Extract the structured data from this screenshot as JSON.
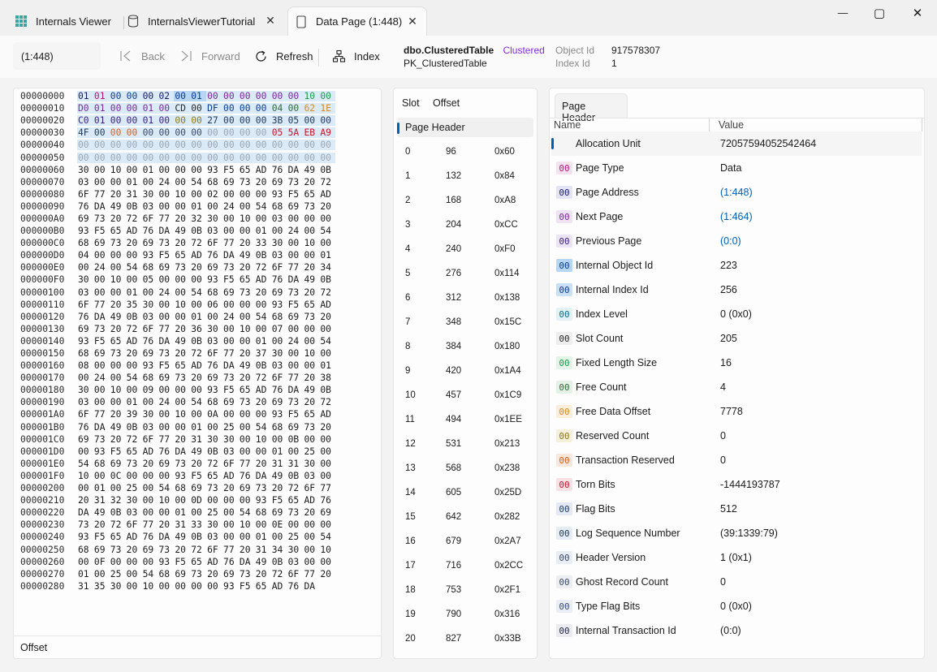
{
  "tabs": [
    {
      "label": "Internals Viewer"
    },
    {
      "label": "InternalsViewerTutorial"
    },
    {
      "label": "Data Page (1:448)"
    }
  ],
  "window": {
    "minimize": "—",
    "maximize": "▢",
    "close": "✕"
  },
  "toolbar": {
    "address": "(1:448)",
    "back": "Back",
    "forward": "Forward",
    "refresh": "Refresh",
    "index": "Index"
  },
  "object_info": {
    "table_name": "dbo.ClusteredTable",
    "index_type": "Clustered",
    "index_name": "PK_ClusteredTable",
    "object_id_label": "Object Id",
    "object_id_value": "917578307",
    "index_id_label": "Index Id",
    "index_id_value": "1"
  },
  "colors": {
    "accent": "#005fb8",
    "header_bytes_bg": "#dbeaf7",
    "selected_bytes_bg": "#b7d6f4"
  },
  "hex": {
    "footer": "Offset",
    "rows": [
      {
        "offset": "00000000",
        "bytes": [
          "01",
          "01",
          "00",
          "00",
          "00",
          "02",
          "00",
          "01",
          "00",
          "00",
          "00",
          "00",
          "00",
          "00",
          "10",
          "00"
        ]
      },
      {
        "offset": "00000010",
        "bytes": [
          "D0",
          "01",
          "00",
          "00",
          "01",
          "00",
          "CD",
          "00",
          "DF",
          "00",
          "00",
          "00",
          "04",
          "00",
          "62",
          "1E"
        ]
      },
      {
        "offset": "00000020",
        "bytes": [
          "C0",
          "01",
          "00",
          "00",
          "01",
          "00",
          "00",
          "00",
          "27",
          "00",
          "00",
          "00",
          "3B",
          "05",
          "00",
          "00"
        ]
      },
      {
        "offset": "00000030",
        "bytes": [
          "4F",
          "00",
          "00",
          "00",
          "00",
          "00",
          "00",
          "00",
          "00",
          "00",
          "00",
          "00",
          "05",
          "5A",
          "EB",
          "A9"
        ]
      },
      {
        "offset": "00000040",
        "bytes": [
          "00",
          "00",
          "00",
          "00",
          "00",
          "00",
          "00",
          "00",
          "00",
          "00",
          "00",
          "00",
          "00",
          "00",
          "00",
          "00"
        ]
      },
      {
        "offset": "00000050",
        "bytes": [
          "00",
          "00",
          "00",
          "00",
          "00",
          "00",
          "00",
          "00",
          "00",
          "00",
          "00",
          "00",
          "00",
          "00",
          "00",
          "00"
        ]
      },
      {
        "offset": "00000060",
        "bytes": [
          "30",
          "00",
          "10",
          "00",
          "01",
          "00",
          "00",
          "00",
          "93",
          "F5",
          "65",
          "AD",
          "76",
          "DA",
          "49",
          "0B"
        ]
      },
      {
        "offset": "00000070",
        "bytes": [
          "03",
          "00",
          "00",
          "01",
          "00",
          "24",
          "00",
          "54",
          "68",
          "69",
          "73",
          "20",
          "69",
          "73",
          "20",
          "72"
        ]
      },
      {
        "offset": "00000080",
        "bytes": [
          "6F",
          "77",
          "20",
          "31",
          "30",
          "00",
          "10",
          "00",
          "02",
          "00",
          "00",
          "00",
          "93",
          "F5",
          "65",
          "AD"
        ]
      },
      {
        "offset": "00000090",
        "bytes": [
          "76",
          "DA",
          "49",
          "0B",
          "03",
          "00",
          "00",
          "01",
          "00",
          "24",
          "00",
          "54",
          "68",
          "69",
          "73",
          "20"
        ]
      },
      {
        "offset": "000000A0",
        "bytes": [
          "69",
          "73",
          "20",
          "72",
          "6F",
          "77",
          "20",
          "32",
          "30",
          "00",
          "10",
          "00",
          "03",
          "00",
          "00",
          "00"
        ]
      },
      {
        "offset": "000000B0",
        "bytes": [
          "93",
          "F5",
          "65",
          "AD",
          "76",
          "DA",
          "49",
          "0B",
          "03",
          "00",
          "00",
          "01",
          "00",
          "24",
          "00",
          "54"
        ]
      },
      {
        "offset": "000000C0",
        "bytes": [
          "68",
          "69",
          "73",
          "20",
          "69",
          "73",
          "20",
          "72",
          "6F",
          "77",
          "20",
          "33",
          "30",
          "00",
          "10",
          "00"
        ]
      },
      {
        "offset": "000000D0",
        "bytes": [
          "04",
          "00",
          "00",
          "00",
          "93",
          "F5",
          "65",
          "AD",
          "76",
          "DA",
          "49",
          "0B",
          "03",
          "00",
          "00",
          "01"
        ]
      },
      {
        "offset": "000000E0",
        "bytes": [
          "00",
          "24",
          "00",
          "54",
          "68",
          "69",
          "73",
          "20",
          "69",
          "73",
          "20",
          "72",
          "6F",
          "77",
          "20",
          "34"
        ]
      },
      {
        "offset": "000000F0",
        "bytes": [
          "30",
          "00",
          "10",
          "00",
          "05",
          "00",
          "00",
          "00",
          "93",
          "F5",
          "65",
          "AD",
          "76",
          "DA",
          "49",
          "0B"
        ]
      },
      {
        "offset": "00000100",
        "bytes": [
          "03",
          "00",
          "00",
          "01",
          "00",
          "24",
          "00",
          "54",
          "68",
          "69",
          "73",
          "20",
          "69",
          "73",
          "20",
          "72"
        ]
      },
      {
        "offset": "00000110",
        "bytes": [
          "6F",
          "77",
          "20",
          "35",
          "30",
          "00",
          "10",
          "00",
          "06",
          "00",
          "00",
          "00",
          "93",
          "F5",
          "65",
          "AD"
        ]
      },
      {
        "offset": "00000120",
        "bytes": [
          "76",
          "DA",
          "49",
          "0B",
          "03",
          "00",
          "00",
          "01",
          "00",
          "24",
          "00",
          "54",
          "68",
          "69",
          "73",
          "20"
        ]
      },
      {
        "offset": "00000130",
        "bytes": [
          "69",
          "73",
          "20",
          "72",
          "6F",
          "77",
          "20",
          "36",
          "30",
          "00",
          "10",
          "00",
          "07",
          "00",
          "00",
          "00"
        ]
      },
      {
        "offset": "00000140",
        "bytes": [
          "93",
          "F5",
          "65",
          "AD",
          "76",
          "DA",
          "49",
          "0B",
          "03",
          "00",
          "00",
          "01",
          "00",
          "24",
          "00",
          "54"
        ]
      },
      {
        "offset": "00000150",
        "bytes": [
          "68",
          "69",
          "73",
          "20",
          "69",
          "73",
          "20",
          "72",
          "6F",
          "77",
          "20",
          "37",
          "30",
          "00",
          "10",
          "00"
        ]
      },
      {
        "offset": "00000160",
        "bytes": [
          "08",
          "00",
          "00",
          "00",
          "93",
          "F5",
          "65",
          "AD",
          "76",
          "DA",
          "49",
          "0B",
          "03",
          "00",
          "00",
          "01"
        ]
      },
      {
        "offset": "00000170",
        "bytes": [
          "00",
          "24",
          "00",
          "54",
          "68",
          "69",
          "73",
          "20",
          "69",
          "73",
          "20",
          "72",
          "6F",
          "77",
          "20",
          "38"
        ]
      },
      {
        "offset": "00000180",
        "bytes": [
          "30",
          "00",
          "10",
          "00",
          "09",
          "00",
          "00",
          "00",
          "93",
          "F5",
          "65",
          "AD",
          "76",
          "DA",
          "49",
          "0B"
        ]
      },
      {
        "offset": "00000190",
        "bytes": [
          "03",
          "00",
          "00",
          "01",
          "00",
          "24",
          "00",
          "54",
          "68",
          "69",
          "73",
          "20",
          "69",
          "73",
          "20",
          "72"
        ]
      },
      {
        "offset": "000001A0",
        "bytes": [
          "6F",
          "77",
          "20",
          "39",
          "30",
          "00",
          "10",
          "00",
          "0A",
          "00",
          "00",
          "00",
          "93",
          "F5",
          "65",
          "AD"
        ]
      },
      {
        "offset": "000001B0",
        "bytes": [
          "76",
          "DA",
          "49",
          "0B",
          "03",
          "00",
          "00",
          "01",
          "00",
          "25",
          "00",
          "54",
          "68",
          "69",
          "73",
          "20"
        ]
      },
      {
        "offset": "000001C0",
        "bytes": [
          "69",
          "73",
          "20",
          "72",
          "6F",
          "77",
          "20",
          "31",
          "30",
          "30",
          "00",
          "10",
          "00",
          "0B",
          "00",
          "00"
        ]
      },
      {
        "offset": "000001D0",
        "bytes": [
          "00",
          "93",
          "F5",
          "65",
          "AD",
          "76",
          "DA",
          "49",
          "0B",
          "03",
          "00",
          "00",
          "01",
          "00",
          "25",
          "00"
        ]
      },
      {
        "offset": "000001E0",
        "bytes": [
          "54",
          "68",
          "69",
          "73",
          "20",
          "69",
          "73",
          "20",
          "72",
          "6F",
          "77",
          "20",
          "31",
          "31",
          "30",
          "00"
        ]
      },
      {
        "offset": "000001F0",
        "bytes": [
          "10",
          "00",
          "0C",
          "00",
          "00",
          "00",
          "93",
          "F5",
          "65",
          "AD",
          "76",
          "DA",
          "49",
          "0B",
          "03",
          "00"
        ]
      },
      {
        "offset": "00000200",
        "bytes": [
          "00",
          "01",
          "00",
          "25",
          "00",
          "54",
          "68",
          "69",
          "73",
          "20",
          "69",
          "73",
          "20",
          "72",
          "6F",
          "77"
        ]
      },
      {
        "offset": "00000210",
        "bytes": [
          "20",
          "31",
          "32",
          "30",
          "00",
          "10",
          "00",
          "0D",
          "00",
          "00",
          "00",
          "93",
          "F5",
          "65",
          "AD",
          "76"
        ]
      },
      {
        "offset": "00000220",
        "bytes": [
          "DA",
          "49",
          "0B",
          "03",
          "00",
          "00",
          "01",
          "00",
          "25",
          "00",
          "54",
          "68",
          "69",
          "73",
          "20",
          "69"
        ]
      },
      {
        "offset": "00000230",
        "bytes": [
          "73",
          "20",
          "72",
          "6F",
          "77",
          "20",
          "31",
          "33",
          "30",
          "00",
          "10",
          "00",
          "0E",
          "00",
          "00",
          "00"
        ]
      },
      {
        "offset": "00000240",
        "bytes": [
          "93",
          "F5",
          "65",
          "AD",
          "76",
          "DA",
          "49",
          "0B",
          "03",
          "00",
          "00",
          "01",
          "00",
          "25",
          "00",
          "54"
        ]
      },
      {
        "offset": "00000250",
        "bytes": [
          "68",
          "69",
          "73",
          "20",
          "69",
          "73",
          "20",
          "72",
          "6F",
          "77",
          "20",
          "31",
          "34",
          "30",
          "00",
          "10"
        ]
      },
      {
        "offset": "00000260",
        "bytes": [
          "00",
          "0F",
          "00",
          "00",
          "00",
          "93",
          "F5",
          "65",
          "AD",
          "76",
          "DA",
          "49",
          "0B",
          "03",
          "00",
          "00"
        ]
      },
      {
        "offset": "00000270",
        "bytes": [
          "01",
          "00",
          "25",
          "00",
          "54",
          "68",
          "69",
          "73",
          "20",
          "69",
          "73",
          "20",
          "72",
          "6F",
          "77",
          "20"
        ]
      },
      {
        "offset": "00000280",
        "bytes": [
          "31",
          "35",
          "30",
          "00",
          "10",
          "00",
          "00",
          "00",
          "00",
          "93",
          "F5",
          "65",
          "AD",
          "76",
          "DA"
        ]
      }
    ]
  },
  "slots": {
    "columns": [
      "Slot",
      "Offset"
    ],
    "selected_label": "Page Header",
    "rows": [
      {
        "slot": "0",
        "offset": "96",
        "hex": "0x60"
      },
      {
        "slot": "1",
        "offset": "132",
        "hex": "0x84"
      },
      {
        "slot": "2",
        "offset": "168",
        "hex": "0xA8"
      },
      {
        "slot": "3",
        "offset": "204",
        "hex": "0xCC"
      },
      {
        "slot": "4",
        "offset": "240",
        "hex": "0xF0"
      },
      {
        "slot": "5",
        "offset": "276",
        "hex": "0x114"
      },
      {
        "slot": "6",
        "offset": "312",
        "hex": "0x138"
      },
      {
        "slot": "7",
        "offset": "348",
        "hex": "0x15C"
      },
      {
        "slot": "8",
        "offset": "384",
        "hex": "0x180"
      },
      {
        "slot": "9",
        "offset": "420",
        "hex": "0x1A4"
      },
      {
        "slot": "10",
        "offset": "457",
        "hex": "0x1C9"
      },
      {
        "slot": "11",
        "offset": "494",
        "hex": "0x1EE"
      },
      {
        "slot": "12",
        "offset": "531",
        "hex": "0x213"
      },
      {
        "slot": "13",
        "offset": "568",
        "hex": "0x238"
      },
      {
        "slot": "14",
        "offset": "605",
        "hex": "0x25D"
      },
      {
        "slot": "15",
        "offset": "642",
        "hex": "0x282"
      },
      {
        "slot": "16",
        "offset": "679",
        "hex": "0x2A7"
      },
      {
        "slot": "17",
        "offset": "716",
        "hex": "0x2CC"
      },
      {
        "slot": "18",
        "offset": "753",
        "hex": "0x2F1"
      },
      {
        "slot": "19",
        "offset": "790",
        "hex": "0x316"
      },
      {
        "slot": "20",
        "offset": "827",
        "hex": "0x33B"
      }
    ]
  },
  "page_header": {
    "tab": "Page Header",
    "columns": [
      "Name",
      "Value"
    ],
    "rows": [
      {
        "name": "Allocation Unit",
        "value": "72057594052542464",
        "chip": ""
      },
      {
        "name": "Page Type",
        "value": "Data",
        "chip": "00",
        "chip_color": "#c0137a",
        "chip_bg": "#f7e3ef"
      },
      {
        "name": "Page Address",
        "value": "(1:448)",
        "chip": "00",
        "chip_color": "#1a1a6b",
        "chip_bg": "#e3e3f5",
        "link": true
      },
      {
        "name": "Next Page",
        "value": "(1:464)",
        "chip": "00",
        "chip_color": "#7a2a9a",
        "chip_bg": "#efe2f5",
        "link": true
      },
      {
        "name": "Previous Page",
        "value": "(0:0)",
        "chip": "00",
        "chip_color": "#3a1f80",
        "chip_bg": "#ebe4f7",
        "link": true
      },
      {
        "name": "Internal Object Id",
        "value": "223",
        "chip": "00",
        "chip_color": "#0b3d91",
        "chip_bg": "#b7d6f4"
      },
      {
        "name": "Internal Index Id",
        "value": "256",
        "chip": "00",
        "chip_color": "#0b3d91",
        "chip_bg": "#c9e0f7"
      },
      {
        "name": "Index Level",
        "value": "0 (0x0)",
        "chip": "00",
        "chip_color": "#0a6e8c",
        "chip_bg": "#e1f1f6"
      },
      {
        "name": "Slot Count",
        "value": "205",
        "chip": "00",
        "chip_color": "#2a2a2a",
        "chip_bg": "#eeeeee"
      },
      {
        "name": "Fixed Length Size",
        "value": "16",
        "chip": "00",
        "chip_color": "#1f9a4a",
        "chip_bg": "#e2f5e8"
      },
      {
        "name": "Free Count",
        "value": "4",
        "chip": "00",
        "chip_color": "#2f6b3a",
        "chip_bg": "#e6f1e6"
      },
      {
        "name": "Free Data Offset",
        "value": "7778",
        "chip": "00",
        "chip_color": "#d98a1a",
        "chip_bg": "#fbefdc"
      },
      {
        "name": "Reserved Count",
        "value": "0",
        "chip": "00",
        "chip_color": "#8a7a1a",
        "chip_bg": "#f4f0dc"
      },
      {
        "name": "Transaction Reserved",
        "value": "0",
        "chip": "00",
        "chip_color": "#d9601a",
        "chip_bg": "#fbe7dc"
      },
      {
        "name": "Torn Bits",
        "value": "-1444193787",
        "chip": "00",
        "chip_color": "#c4162a",
        "chip_bg": "#f9e1e3"
      },
      {
        "name": "Flag Bits",
        "value": "512",
        "chip": "00",
        "chip_color": "#1f3a6b",
        "chip_bg": "#e4eaf5"
      },
      {
        "name": "Log Sequence Number",
        "value": "(39:1339:79)",
        "chip": "00",
        "chip_color": "#1f3a5a",
        "chip_bg": "#e6ecf3"
      },
      {
        "name": "Header Version",
        "value": "1 (0x1)",
        "chip": "00",
        "chip_color": "#3a4a6a",
        "chip_bg": "#e9edf4"
      },
      {
        "name": "Ghost Record Count",
        "value": "0",
        "chip": "00",
        "chip_color": "#3a4a6a",
        "chip_bg": "#eceef3"
      },
      {
        "name": "Type Flag Bits",
        "value": "0 (0x0)",
        "chip": "00",
        "chip_color": "#3a4a7a",
        "chip_bg": "#eaedf5"
      },
      {
        "name": "Internal Transaction Id",
        "value": "(0:0)",
        "chip": "00",
        "chip_color": "#2a2a4a",
        "chip_bg": "#ebebf0"
      }
    ]
  }
}
